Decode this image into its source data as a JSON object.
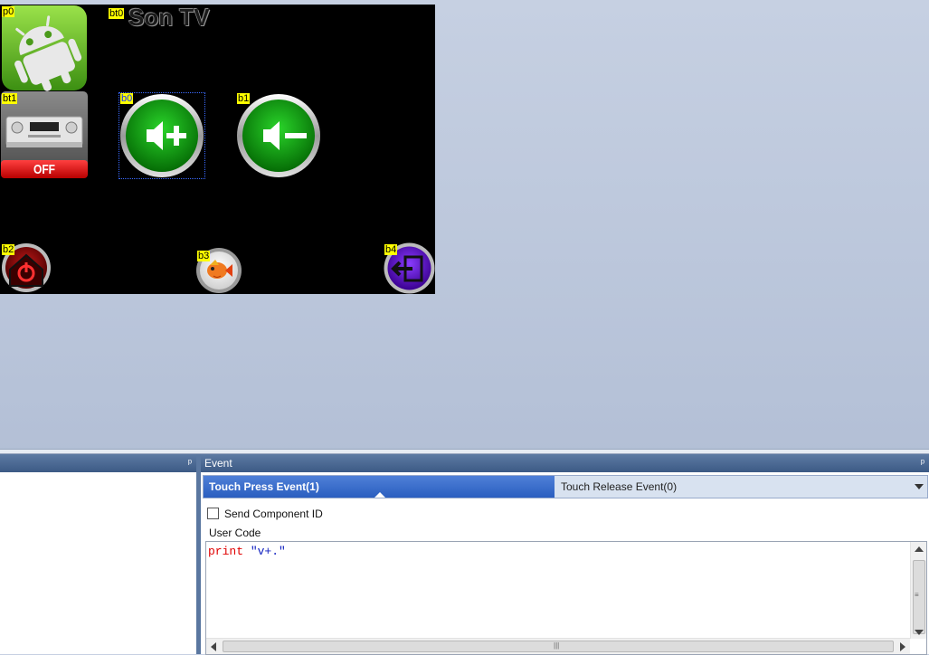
{
  "canvas": {
    "title": "Son TV",
    "component_ids": {
      "p0": "p0",
      "bt0": "bt0",
      "bt1": "bt1",
      "b0": "b0",
      "b1": "b1",
      "b2": "b2",
      "b3": "b3",
      "b4": "b4"
    },
    "bt1_label": "OFF",
    "icons": {
      "p0": "android-logo-icon",
      "bt1": "av-receiver-icon",
      "b0": "volume-up-icon",
      "b1": "volume-down-icon",
      "b2": "home-power-icon",
      "b3": "fish-icon",
      "b4": "back-arrow-icon"
    }
  },
  "left_panel": {
    "pin": "ᵖ"
  },
  "event_panel": {
    "title": "Event",
    "pin": "ᵖ",
    "tabs": [
      {
        "label": "Touch Press Event(1)",
        "active": true
      },
      {
        "label": "Touch Release Event(0)",
        "active": false
      }
    ],
    "send_component_id": {
      "label": "Send Component ID",
      "checked": false
    },
    "user_code_label": "User Code",
    "code": {
      "keyword": "print",
      "space": " ",
      "string": "\"v+.\""
    }
  },
  "colors": {
    "panel_header": "#3c5a85",
    "active_tab": "#2a5ec0",
    "canvas_bg": "#000000",
    "tag_bg": "#ffff00",
    "keyword": "#e00000",
    "string": "#1020c0"
  }
}
